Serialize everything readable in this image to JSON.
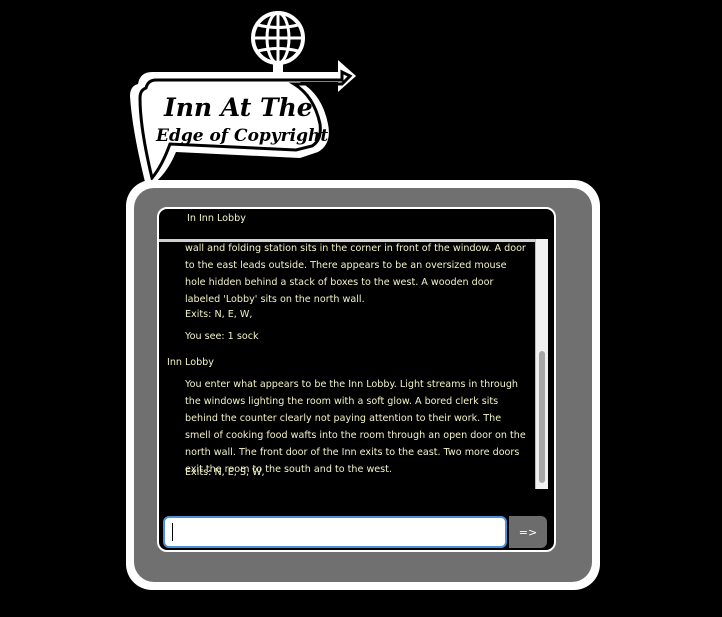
{
  "sign": {
    "line1": "Inn At The",
    "line2": "Edge of Copyright",
    "icon": "globe-icon"
  },
  "game": {
    "current_room_header": "In Inn Lobby",
    "log": [
      {
        "kind": "text",
        "text": "wall and folding station sits in the corner in front of the window. A door to the east leads outside. There appears to be an oversized mouse hole hidden behind a stack of boxes to the west. A wooden door labeled 'Lobby' sits on the north wall."
      },
      {
        "kind": "text",
        "text": "Exits: N, E, W,"
      },
      {
        "kind": "text",
        "text": "You see: 1 sock"
      },
      {
        "kind": "title",
        "text": "Inn Lobby"
      },
      {
        "kind": "text",
        "text": "You enter what appears to be the Inn Lobby. Light streams in through the windows lighting the room with a soft glow. A bored clerk sits behind the counter clearly not paying attention to their work. The smell of cooking food wafts into the room through an open door on the north wall. The front door of the Inn exits to the east. Two more doors exit the room to the south and to the west."
      },
      {
        "kind": "text",
        "text": "Exits: N, E, S, W,"
      }
    ]
  },
  "command": {
    "value": "",
    "submit_label": "=>"
  },
  "colors": {
    "text": "#f3f3c8",
    "tv_frame": "#707070",
    "input_focus": "#4d8fd6"
  }
}
